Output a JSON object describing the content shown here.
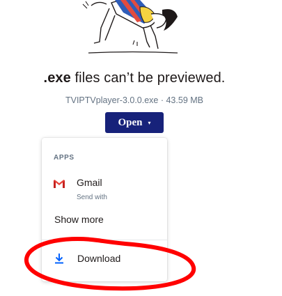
{
  "preview": {
    "title_bold": ".exe",
    "title_rest": " files can’t be previewed.",
    "file_meta": "TVIPTVplayer-3.0.0.exe · 43.59 MB"
  },
  "open_button": {
    "label": "Open",
    "caret": "▾",
    "color": "#17227a"
  },
  "menu": {
    "section_label": "APPS",
    "items": [
      {
        "label": "Gmail",
        "sublabel": "Send with",
        "icon": "gmail-icon"
      },
      {
        "label": "Show more"
      },
      {
        "label": "Download",
        "icon": "download-icon"
      }
    ]
  },
  "annotation": {
    "color": "#ff0000",
    "shape": "hand-drawn circle around Download"
  }
}
